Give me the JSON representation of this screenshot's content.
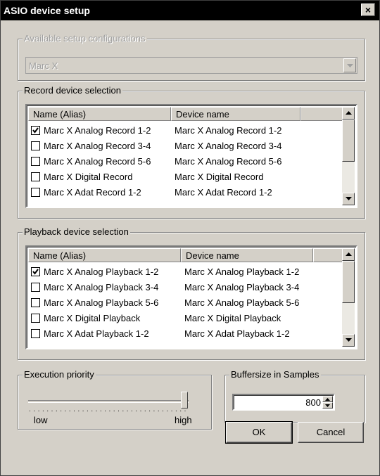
{
  "window": {
    "title": "ASIO device setup"
  },
  "setup": {
    "legend": "Available setup configurations",
    "selected": "Marc X"
  },
  "record": {
    "legend": "Record device selection",
    "columns": [
      "Name (Alias)",
      "Device name"
    ],
    "rows": [
      {
        "alias": "Marc X Analog Record 1-2",
        "device": "Marc X Analog Record 1-2",
        "checked": true
      },
      {
        "alias": "Marc X Analog Record 3-4",
        "device": "Marc X Analog Record 3-4",
        "checked": false
      },
      {
        "alias": "Marc X Analog Record 5-6",
        "device": "Marc X Analog Record 5-6",
        "checked": false
      },
      {
        "alias": "Marc X Digital Record",
        "device": "Marc X Digital Record",
        "checked": false
      },
      {
        "alias": "Marc X Adat Record 1-2",
        "device": "Marc X Adat Record 1-2",
        "checked": false
      }
    ]
  },
  "playback": {
    "legend": "Playback device selection",
    "columns": [
      "Name (Alias)",
      "Device name"
    ],
    "rows": [
      {
        "alias": "Marc X Analog Playback 1-2",
        "device": "Marc X Analog Playback 1-2",
        "checked": true
      },
      {
        "alias": "Marc X Analog Playback 3-4",
        "device": "Marc X Analog Playback 3-4",
        "checked": false
      },
      {
        "alias": "Marc X Analog Playback 5-6",
        "device": "Marc X Analog Playback 5-6",
        "checked": false
      },
      {
        "alias": "Marc X Digital Playback",
        "device": "Marc X Digital Playback",
        "checked": false
      },
      {
        "alias": "Marc X Adat Playback 1-2",
        "device": "Marc X Adat Playback 1-2",
        "checked": false
      }
    ]
  },
  "priority": {
    "legend": "Execution priority",
    "low_label": "low",
    "high_label": "high",
    "level": 1.0
  },
  "buffer": {
    "legend": "Buffersize in Samples",
    "value": "800"
  },
  "buttons": {
    "ok": "OK",
    "cancel": "Cancel"
  }
}
